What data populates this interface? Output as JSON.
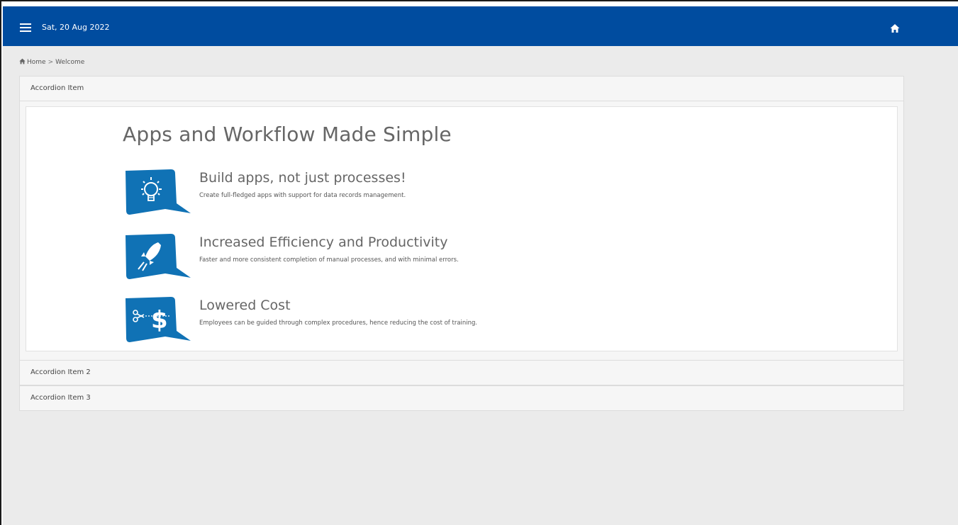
{
  "topbar": {
    "date": "Sat, 20 Aug 2022",
    "menu_icon": "hamburger-menu-icon",
    "home_icon": "home-icon",
    "bg_color": "#004c9f"
  },
  "breadcrumb": {
    "home_icon": "home-icon",
    "home_label": "Home",
    "separator": ">",
    "current": "Welcome"
  },
  "accordion": {
    "items": [
      {
        "label": "Accordion Item"
      },
      {
        "label": "Accordion Item 2"
      },
      {
        "label": "Accordion Item 3"
      }
    ]
  },
  "welcome": {
    "headline": "Apps and Workflow Made Simple",
    "features": [
      {
        "title": "Build apps, not just processes!",
        "description": "Create full-fledged apps with support for data records management.",
        "icon": "lightbulb-icon"
      },
      {
        "title": "Increased Efficiency and Productivity",
        "description": "Faster and more consistent completion of manual processes, and with minimal errors.",
        "icon": "rocket-icon"
      },
      {
        "title": "Lowered Cost",
        "description": "Employees can be guided through complex procedures, hence reducing the cost of training.",
        "icon": "dollar-scissors-icon"
      }
    ],
    "icon_color": "#1072b5"
  }
}
